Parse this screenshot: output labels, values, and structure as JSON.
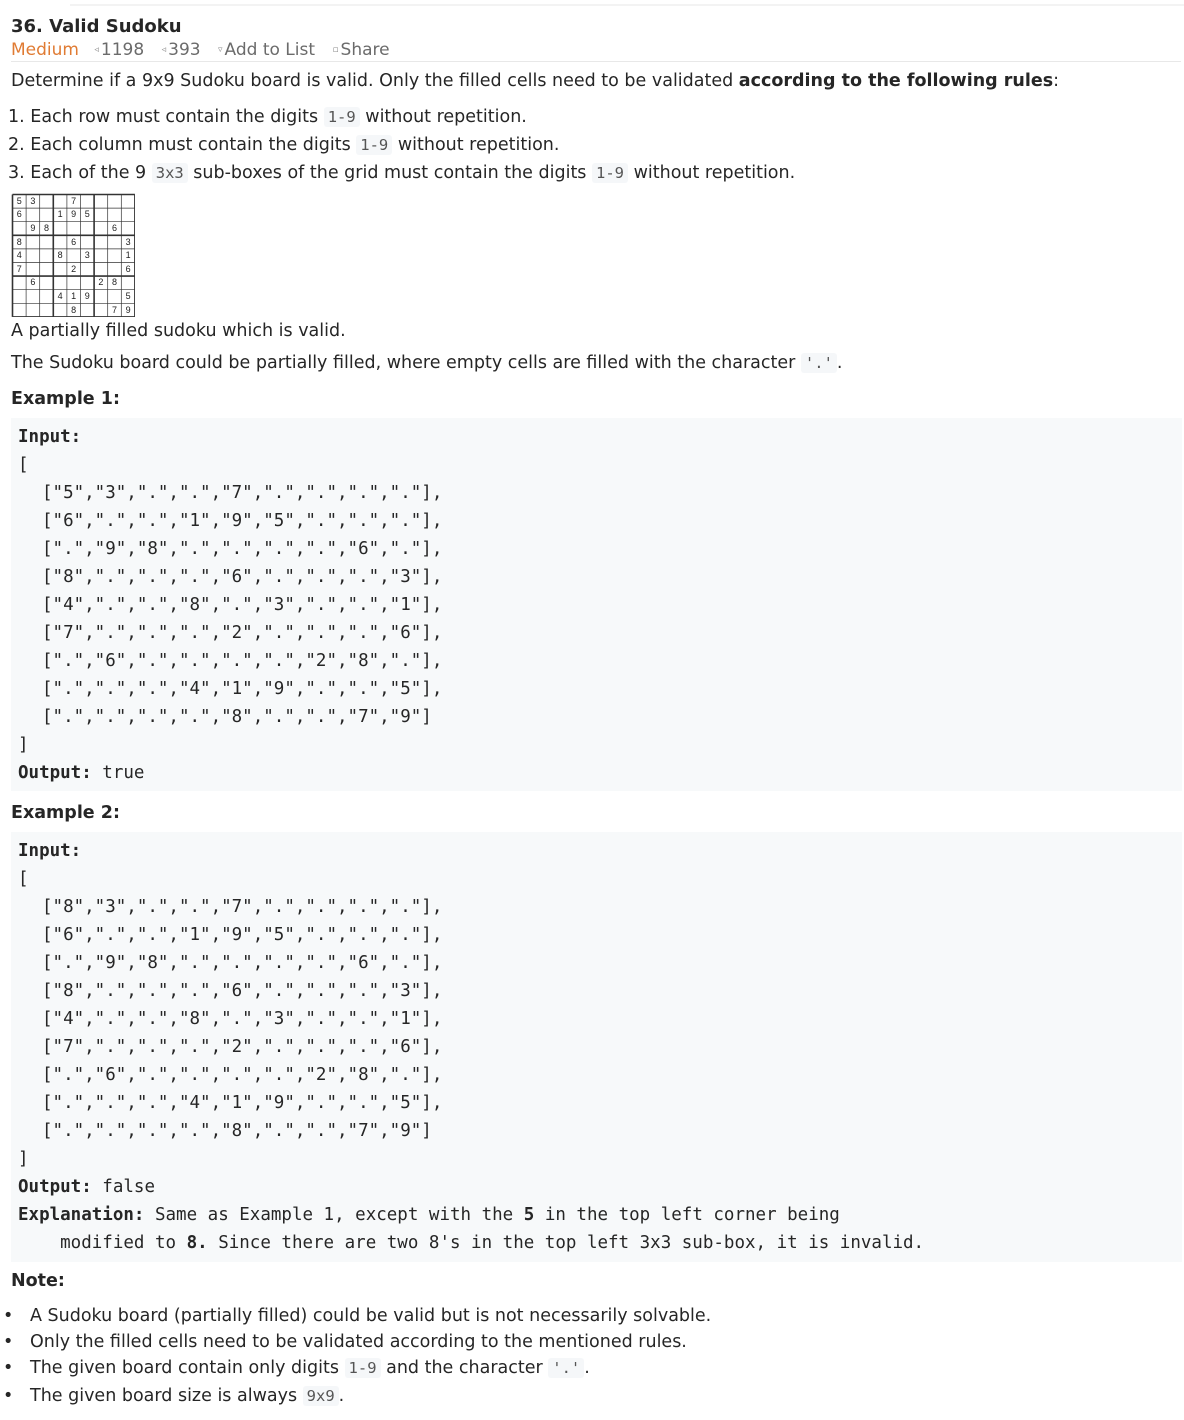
{
  "problem": {
    "title": "36. Valid Sudoku",
    "difficulty": "Medium",
    "likes": "1198",
    "dislikes": "393",
    "add_to_list": "Add to List",
    "share": "Share"
  },
  "description": {
    "intro_text": "Determine if a 9x9 Sudoku board is valid. Only the filled cells need to be validated ",
    "intro_bold": "according to the following rules",
    "intro_end": ":",
    "rules": [
      {
        "pre": "1. Each row must contain the digits ",
        "code": "1-9",
        "post": " without repetition."
      },
      {
        "pre": "2. Each column must contain the digits ",
        "code": "1-9",
        "post": " without repetition."
      },
      {
        "pre": "3. Each of the 9 ",
        "code": "3x3",
        "mid": " sub-boxes of the grid must contain the digits ",
        "code2": "1-9",
        "post": " without repetition."
      }
    ],
    "caption": "A partially filled sudoku which is valid.",
    "partial_text": "The Sudoku board could be partially filled, where empty cells are filled with the character ",
    "partial_code": "'.'",
    "partial_end": "."
  },
  "sudoku": [
    [
      "5",
      "3",
      "",
      "",
      "7",
      "",
      "",
      "",
      ""
    ],
    [
      "6",
      "",
      "",
      "1",
      "9",
      "5",
      "",
      "",
      ""
    ],
    [
      "",
      "9",
      "8",
      "",
      "",
      "",
      "",
      "6",
      ""
    ],
    [
      "8",
      "",
      "",
      "",
      "6",
      "",
      "",
      "",
      "3"
    ],
    [
      "4",
      "",
      "",
      "8",
      "",
      "3",
      "",
      "",
      "1"
    ],
    [
      "7",
      "",
      "",
      "",
      "2",
      "",
      "",
      "",
      "6"
    ],
    [
      "",
      "6",
      "",
      "",
      "",
      "",
      "2",
      "8",
      ""
    ],
    [
      "",
      "",
      "",
      "4",
      "1",
      "9",
      "",
      "",
      "5"
    ],
    [
      "",
      "",
      "",
      "",
      "8",
      "",
      "",
      "7",
      "9"
    ]
  ],
  "example1": {
    "heading": "Example 1:",
    "input_label": "Input:",
    "open": "[",
    "lines": [
      "[\"5\",\"3\",\".\",\".\",\"7\",\".\",\".\",\".\",\".\"],",
      "[\"6\",\".\",\".\",\"1\",\"9\",\"5\",\".\",\".\",\".\"],",
      "[\".\",\"9\",\"8\",\".\",\".\",\".\",\".\",\"6\",\".\"],",
      "[\"8\",\".\",\".\",\".\",\"6\",\".\",\".\",\".\",\"3\"],",
      "[\"4\",\".\",\".\",\"8\",\".\",\"3\",\".\",\".\",\"1\"],",
      "[\"7\",\".\",\".\",\".\",\"2\",\".\",\".\",\".\",\"6\"],",
      "[\".\",\"6\",\".\",\".\",\".\",\".\",\"2\",\"8\",\".\"],",
      "[\".\",\".\",\".\",\"4\",\"1\",\"9\",\".\",\".\",\"5\"],",
      "[\".\",\".\",\".\",\".\",\"8\",\".\",\".\",\"7\",\"9\"]"
    ],
    "close": "]",
    "output_label": "Output:",
    "output_value": " true"
  },
  "example2": {
    "heading": "Example 2:",
    "input_label": "Input:",
    "open": "[",
    "lines": [
      "[\"8\",\"3\",\".\",\".\",\"7\",\".\",\".\",\".\",\".\"],",
      "[\"6\",\".\",\".\",\"1\",\"9\",\"5\",\".\",\".\",\".\"],",
      "[\".\",\"9\",\"8\",\".\",\".\",\".\",\".\",\"6\",\".\"],",
      "[\"8\",\".\",\".\",\".\",\"6\",\".\",\".\",\".\",\"3\"],",
      "[\"4\",\".\",\".\",\"8\",\".\",\"3\",\".\",\".\",\"1\"],",
      "[\"7\",\".\",\".\",\".\",\"2\",\".\",\".\",\".\",\"6\"],",
      "[\".\",\"6\",\".\",\".\",\".\",\".\",\"2\",\"8\",\".\"],",
      "[\".\",\".\",\".\",\"4\",\"1\",\"9\",\".\",\".\",\"5\"],",
      "[\".\",\".\",\".\",\".\",\"8\",\".\",\".\",\"7\",\"9\"]"
    ],
    "close": "]",
    "output_label": "Output:",
    "output_value": " false",
    "explanation_label": "Explanation:",
    "explanation_a": " Same as Example 1, except with the ",
    "explanation_b1": "5",
    "explanation_c": " in the top left corner being",
    "explanation_d": "    modified to ",
    "explanation_b2": "8.",
    "explanation_e": " Since there are two 8's in the top left 3x3 sub-box, it is invalid."
  },
  "note": {
    "heading": "Note:",
    "b1": "A Sudoku board (partially filled) could be valid but is not necessarily solvable.",
    "b2": "Only the filled cells need to be validated according to the mentioned rules.",
    "b3_pre": "The given board contain only digits ",
    "b3_code1": "1-9",
    "b3_mid": " and the character ",
    "b3_code2": "'.'",
    "b3_end": ".",
    "b4_pre": "The given board size is always ",
    "b4_code": "9x9",
    "b4_end": "."
  }
}
